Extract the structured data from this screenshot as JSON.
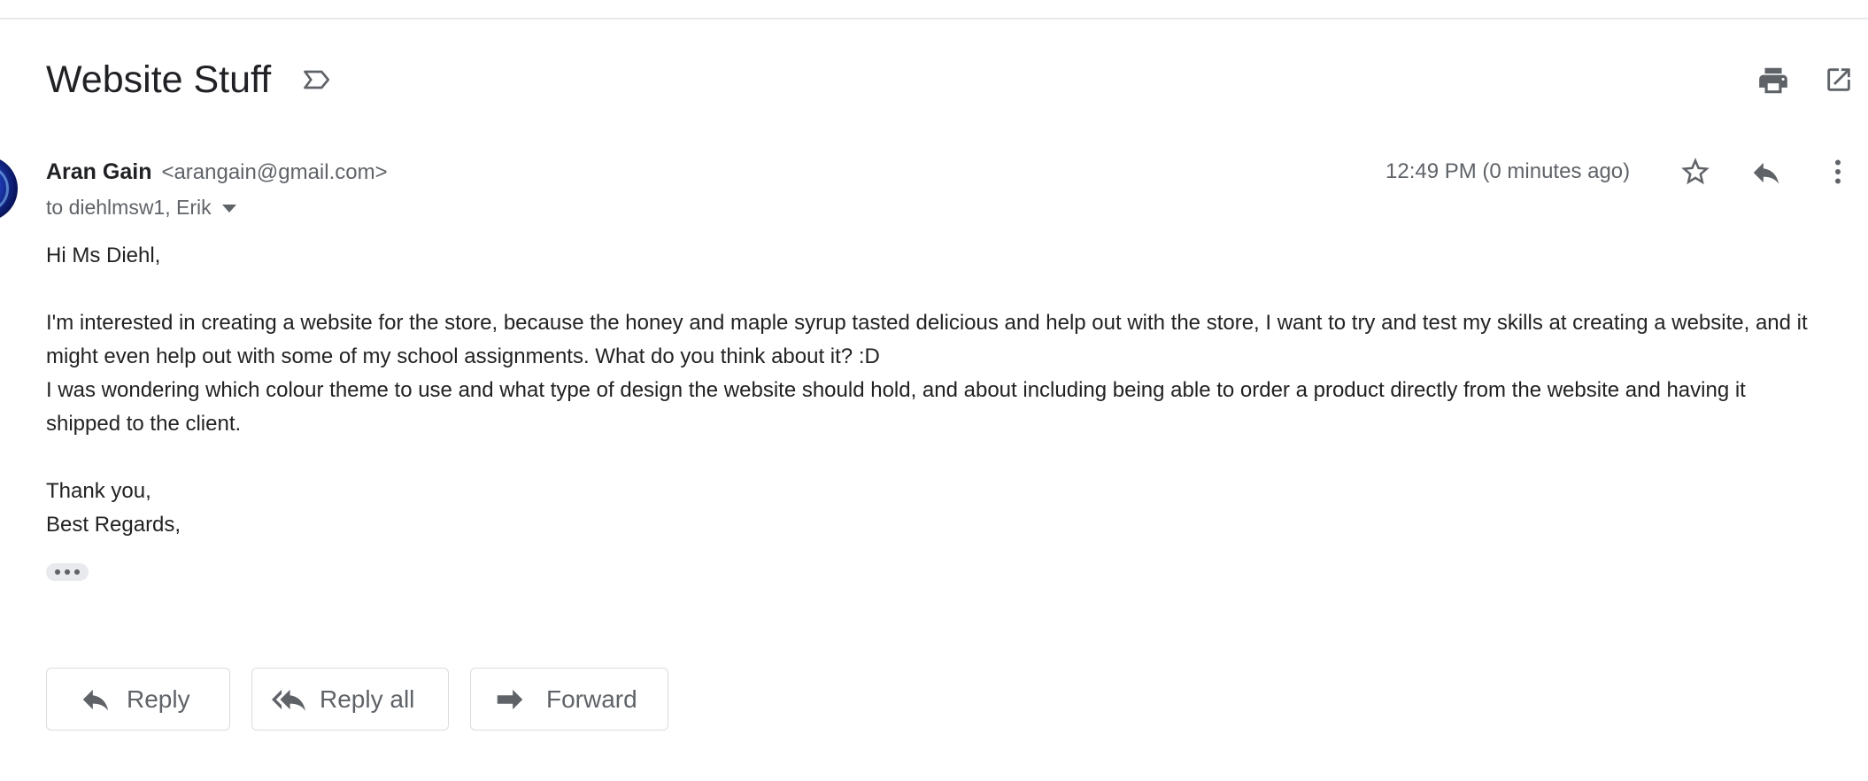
{
  "subject": "Website Stuff",
  "sender": {
    "name": "Aran Gain",
    "email": "<arangain@gmail.com>",
    "recipients": "to diehlmsw1, Erik"
  },
  "timestamp": "12:49 PM (0 minutes ago)",
  "body": {
    "greeting": "Hi Ms Diehl,",
    "paragraph1": "I'm interested in creating a website for the store, because the honey and maple syrup tasted delicious and help out with the store, I want to try and test my skills at creating a website, and it might even help out with some of my school assignments. What do you think about it? :D",
    "paragraph2": "I was wondering which colour theme to use and what type of design the website should hold, and about including being able to order a product directly from the website and having it shipped to the client.",
    "closing1": "Thank you,",
    "closing2": "Best Regards,"
  },
  "actions": {
    "reply": "Reply",
    "reply_all": "Reply all",
    "forward": "Forward"
  },
  "icons": {
    "label": "label-icon",
    "print": "print-icon",
    "popout": "open-in-new-window-icon",
    "star": "star-icon",
    "reply": "reply-icon",
    "more": "more-vertical-icon",
    "trimmed": "show-trimmed-content-icon"
  },
  "colors": {
    "text_primary": "#202124",
    "text_secondary": "#5f6368",
    "divider": "#e8eaed"
  }
}
